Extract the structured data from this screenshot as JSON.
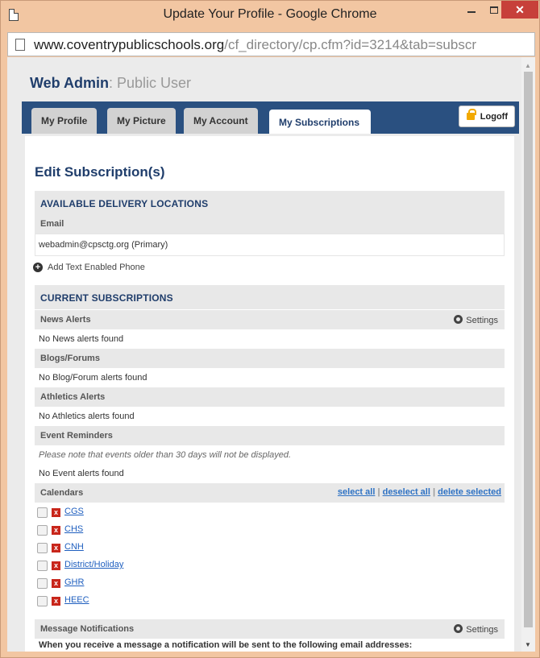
{
  "window": {
    "title": "Update Your Profile - Google Chrome",
    "url_host": "www.coventrypublicschools.org",
    "url_path": "/cf_directory/cp.cfm?id=3214&tab=subscr"
  },
  "header": {
    "site": "Web Admin",
    "role": ": Public User"
  },
  "tabs": [
    {
      "label": "My Profile"
    },
    {
      "label": "My Picture"
    },
    {
      "label": "My Account"
    },
    {
      "label": "My Subscriptions"
    }
  ],
  "logoff_label": "Logoff",
  "page_title": "Edit Subscription(s)",
  "delivery": {
    "heading": "AVAILABLE DELIVERY LOCATIONS",
    "email_label": "Email",
    "email_value": "webadmin@cpsctg.org",
    "email_tag": "(Primary)",
    "add_phone": "Add Text Enabled Phone"
  },
  "subscriptions": {
    "heading": "CURRENT SUBSCRIPTIONS",
    "settings_label": "Settings",
    "news": {
      "label": "News Alerts",
      "empty": "No News alerts found"
    },
    "blogs": {
      "label": "Blogs/Forums",
      "empty": "No Blog/Forum alerts found"
    },
    "athletics": {
      "label": "Athletics Alerts",
      "empty": "No Athletics alerts found"
    },
    "events": {
      "label": "Event Reminders",
      "note": "Please note that events older than 30 days will not be displayed.",
      "empty": "No Event alerts found"
    },
    "calendars": {
      "label": "Calendars",
      "select_all": "select all",
      "deselect_all": "deselect all",
      "delete_selected": "delete selected",
      "separator": "|",
      "items": [
        "CGS",
        "CHS",
        "CNH",
        "District/Holiday",
        "GHR",
        "HEEC"
      ]
    },
    "messages": {
      "label": "Message Notifications",
      "note": "When you receive a message a notification will be sent to the following email addresses:"
    }
  }
}
